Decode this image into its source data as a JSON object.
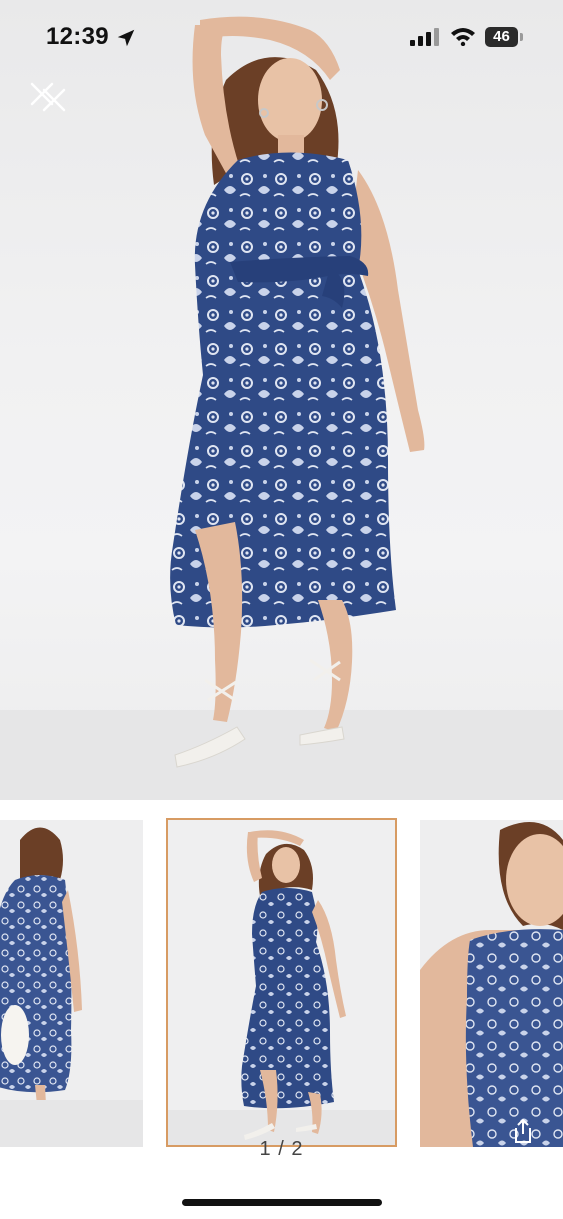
{
  "status_bar": {
    "time": "12:39",
    "battery_level": "46",
    "location_icon": "location-arrow-icon",
    "signal_icon": "cellular-signal-icon",
    "wifi_icon": "wifi-icon",
    "battery_icon": "battery-icon"
  },
  "viewer": {
    "close_icon": "close-icon",
    "page_indicator": "1 / 2",
    "selected_thumbnail": 2
  },
  "colors": {
    "dress_blue": "#2f4a86",
    "thumb_selected_border": "#d79b63",
    "background": "#ffffff"
  }
}
